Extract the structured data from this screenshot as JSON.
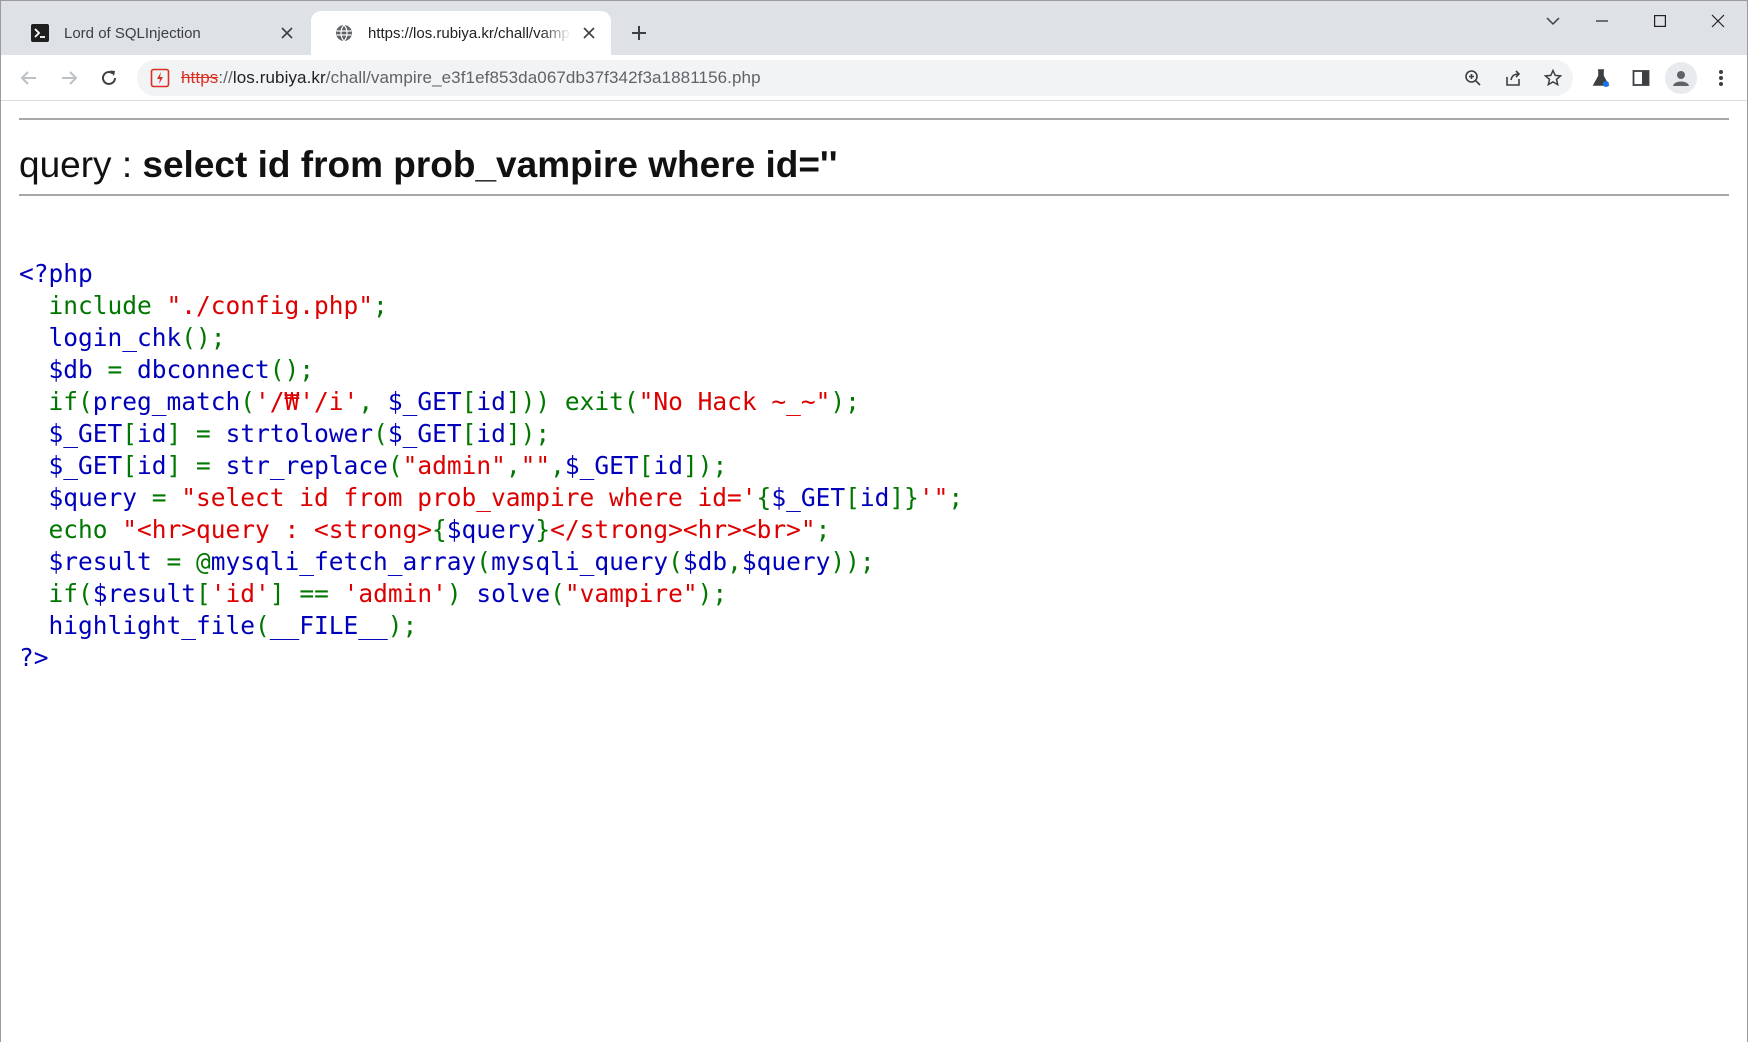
{
  "browser": {
    "tabs": [
      {
        "title": "Lord of SQLInjection",
        "active": false,
        "favicon": "terminal-icon"
      },
      {
        "title": "https://los.rubiya.kr/chall/vampire",
        "active": true,
        "favicon": "globe-icon"
      }
    ],
    "address_bar": {
      "scheme": "https",
      "rest_prefix": "://",
      "host": "los.rubiya.kr",
      "path": "/chall/vampire_e3f1ef853da067db37f342f3a1881156.php",
      "security_icon": "not-secure-icon"
    }
  },
  "page": {
    "query_label": "query : ",
    "query_value": "select id from prob_vampire where id=''",
    "code_lines": [
      [
        {
          "t": "<?php",
          "c": "default"
        }
      ],
      [
        {
          "t": "  include ",
          "c": "keyword"
        },
        {
          "t": "\"./config.php\"",
          "c": "string"
        },
        {
          "t": ";",
          "c": "keyword"
        }
      ],
      [
        {
          "t": "  login_chk",
          "c": "default"
        },
        {
          "t": "();",
          "c": "keyword"
        }
      ],
      [
        {
          "t": "  $db ",
          "c": "default"
        },
        {
          "t": "= ",
          "c": "keyword"
        },
        {
          "t": "dbconnect",
          "c": "default"
        },
        {
          "t": "();",
          "c": "keyword"
        }
      ],
      [
        {
          "t": "  if(",
          "c": "keyword"
        },
        {
          "t": "preg_match",
          "c": "default"
        },
        {
          "t": "(",
          "c": "keyword"
        },
        {
          "t": "'/₩'/i'",
          "c": "string"
        },
        {
          "t": ", ",
          "c": "keyword"
        },
        {
          "t": "$_GET",
          "c": "default"
        },
        {
          "t": "[",
          "c": "keyword"
        },
        {
          "t": "id",
          "c": "default"
        },
        {
          "t": "])) exit(",
          "c": "keyword"
        },
        {
          "t": "\"No Hack ~_~\"",
          "c": "string"
        },
        {
          "t": ");",
          "c": "keyword"
        }
      ],
      [
        {
          "t": "  $_GET",
          "c": "default"
        },
        {
          "t": "[",
          "c": "keyword"
        },
        {
          "t": "id",
          "c": "default"
        },
        {
          "t": "] = ",
          "c": "keyword"
        },
        {
          "t": "strtolower",
          "c": "default"
        },
        {
          "t": "(",
          "c": "keyword"
        },
        {
          "t": "$_GET",
          "c": "default"
        },
        {
          "t": "[",
          "c": "keyword"
        },
        {
          "t": "id",
          "c": "default"
        },
        {
          "t": "]);",
          "c": "keyword"
        }
      ],
      [
        {
          "t": "  $_GET",
          "c": "default"
        },
        {
          "t": "[",
          "c": "keyword"
        },
        {
          "t": "id",
          "c": "default"
        },
        {
          "t": "] = ",
          "c": "keyword"
        },
        {
          "t": "str_replace",
          "c": "default"
        },
        {
          "t": "(",
          "c": "keyword"
        },
        {
          "t": "\"admin\"",
          "c": "string"
        },
        {
          "t": ",",
          "c": "keyword"
        },
        {
          "t": "\"\"",
          "c": "string"
        },
        {
          "t": ",",
          "c": "keyword"
        },
        {
          "t": "$_GET",
          "c": "default"
        },
        {
          "t": "[",
          "c": "keyword"
        },
        {
          "t": "id",
          "c": "default"
        },
        {
          "t": "]);",
          "c": "keyword"
        }
      ],
      [
        {
          "t": "  $query ",
          "c": "default"
        },
        {
          "t": "= ",
          "c": "keyword"
        },
        {
          "t": "\"select id from prob_vampire where id='",
          "c": "string"
        },
        {
          "t": "{",
          "c": "keyword"
        },
        {
          "t": "$_GET",
          "c": "default"
        },
        {
          "t": "[",
          "c": "keyword"
        },
        {
          "t": "id",
          "c": "default"
        },
        {
          "t": "]}",
          "c": "keyword"
        },
        {
          "t": "'\"",
          "c": "string"
        },
        {
          "t": ";",
          "c": "keyword"
        }
      ],
      [
        {
          "t": "  echo ",
          "c": "keyword"
        },
        {
          "t": "\"<hr>query : <strong>",
          "c": "string"
        },
        {
          "t": "{",
          "c": "keyword"
        },
        {
          "t": "$query",
          "c": "default"
        },
        {
          "t": "}",
          "c": "keyword"
        },
        {
          "t": "</strong><hr><br>\"",
          "c": "string"
        },
        {
          "t": ";",
          "c": "keyword"
        }
      ],
      [
        {
          "t": "  $result ",
          "c": "default"
        },
        {
          "t": "= @",
          "c": "keyword"
        },
        {
          "t": "mysqli_fetch_array",
          "c": "default"
        },
        {
          "t": "(",
          "c": "keyword"
        },
        {
          "t": "mysqli_query",
          "c": "default"
        },
        {
          "t": "(",
          "c": "keyword"
        },
        {
          "t": "$db",
          "c": "default"
        },
        {
          "t": ",",
          "c": "keyword"
        },
        {
          "t": "$query",
          "c": "default"
        },
        {
          "t": "));",
          "c": "keyword"
        }
      ],
      [
        {
          "t": "  if(",
          "c": "keyword"
        },
        {
          "t": "$result",
          "c": "default"
        },
        {
          "t": "[",
          "c": "keyword"
        },
        {
          "t": "'id'",
          "c": "string"
        },
        {
          "t": "] == ",
          "c": "keyword"
        },
        {
          "t": "'admin'",
          "c": "string"
        },
        {
          "t": ") ",
          "c": "keyword"
        },
        {
          "t": "solve",
          "c": "default"
        },
        {
          "t": "(",
          "c": "keyword"
        },
        {
          "t": "\"vampire\"",
          "c": "string"
        },
        {
          "t": ");",
          "c": "keyword"
        }
      ],
      [
        {
          "t": "  highlight_file",
          "c": "default"
        },
        {
          "t": "(",
          "c": "keyword"
        },
        {
          "t": "__FILE__",
          "c": "default"
        },
        {
          "t": ");",
          "c": "keyword"
        }
      ],
      [
        {
          "t": "?>",
          "c": "default"
        }
      ]
    ]
  },
  "colors": {
    "php_default": "#0000bb",
    "php_keyword": "#007700",
    "php_string": "#dd0000",
    "tabstrip_bg": "#dee1e6",
    "omnibox_bg": "#f1f3f4",
    "insecure_red": "#d93025"
  }
}
